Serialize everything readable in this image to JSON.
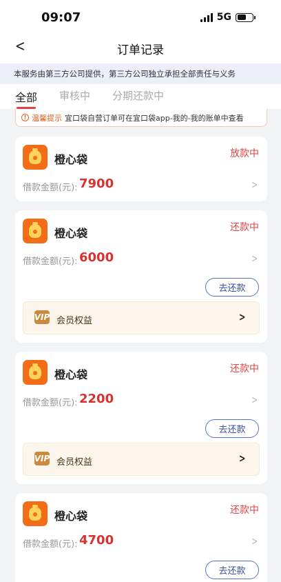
{
  "status_bar": {
    "time": "09:07",
    "network": "5G"
  },
  "nav": {
    "back_icon": "chevron-left-icon",
    "title": "订单记录"
  },
  "notice": "本服务由第三方公司提供，第三方公司独立承担全部责任与义务",
  "tabs": [
    {
      "label": "全部",
      "active": true
    },
    {
      "label": "审核中",
      "active": false
    },
    {
      "label": "分期还款中",
      "active": false
    }
  ],
  "tip": {
    "icon": "info-icon",
    "label": "温馨提示",
    "text": "宜口袋自营订单可在宜口袋app-我的-我的账单中查看"
  },
  "orders": [
    {
      "brand": "橙心袋",
      "status": "放款中",
      "amount_label": "借款金额(元):",
      "amount": "7900"
    },
    {
      "brand": "橙心袋",
      "status": "还款中",
      "amount_label": "借款金额(元):",
      "amount": "6000",
      "repay_label": "去还款",
      "member_label": "会员权益",
      "member_icon_text": "VIP"
    },
    {
      "brand": "橙心袋",
      "status": "还款中",
      "amount_label": "借款金额(元):",
      "amount": "2200",
      "repay_label": "去还款",
      "member_label": "会员权益",
      "member_icon_text": "VIP"
    },
    {
      "brand": "橙心袋",
      "status": "还款中",
      "amount_label": "借款金额(元):",
      "amount": "4700",
      "repay_label": "去还款"
    }
  ],
  "colors": {
    "accent_red": "#e04444",
    "brand_orange": "#f36d18",
    "button_blue": "#3a4fa0"
  }
}
